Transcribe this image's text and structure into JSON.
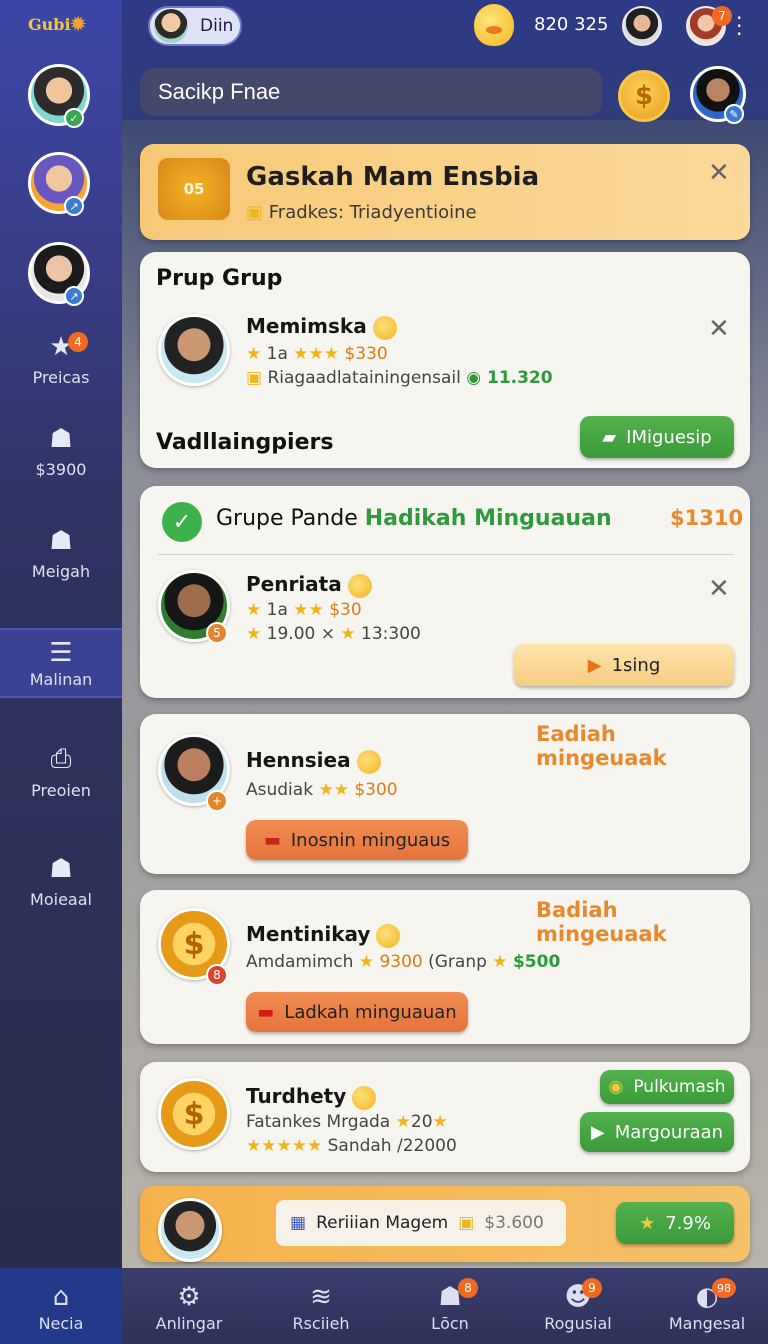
{
  "app": {
    "logo_text": "Gubi",
    "user_label": "Diin",
    "coins": "820 325",
    "notif_count": "7"
  },
  "search": {
    "value": "Sacikp Fnae"
  },
  "sidebar": {
    "items": [
      {
        "label": "Preicas",
        "icon": "star-icon",
        "badge": "4"
      },
      {
        "label": "$3900",
        "icon": "group-icon"
      },
      {
        "label": "Meigah",
        "icon": "bag-icon"
      },
      {
        "label": "Malinan",
        "icon": "list-icon"
      },
      {
        "label": "Preoien",
        "icon": "profile-icon"
      },
      {
        "label": "Moieaal",
        "icon": "bag-icon"
      }
    ]
  },
  "banner": {
    "cart_text": "05",
    "title": "Gaskah Mam Ensbia",
    "subtitle": "Fradkes: Triadyentioine"
  },
  "group_card": {
    "title": "Prup Grup",
    "name": "Memimska",
    "rating": "1a",
    "money": "$330",
    "detail": "Riagaadlatainingensail",
    "score": "11.320",
    "section": "Vadllaingpiers",
    "button": "IMiguesip"
  },
  "pande_card": {
    "title_a": "Grupe Pande",
    "title_b": "Hadikah Minguauan",
    "amount": "$1310",
    "name": "Penriata",
    "line1_rating": "1a",
    "line1_money": "$30",
    "line2_a": "19.00",
    "line2_b": "13:300",
    "button": "1sing",
    "avatar_badge": "5"
  },
  "card3": {
    "header": "Eadiah mingeuaak",
    "name": "Hennsiea",
    "line_a": "Asudiak",
    "money": "$300",
    "button": "Inosnin minguaus"
  },
  "card4": {
    "header": "Badiah mingeuaak",
    "name": "Mentinikay",
    "line_a": "Amdamimch",
    "num": "9300",
    "line_b": "(Granp",
    "money": "$500",
    "button": "Ladkah minguauan",
    "badge": "8"
  },
  "card5": {
    "name": "Turdhety",
    "line1": "Fatankes Mrgada",
    "line1_num": "20",
    "line2": "Sandah /22000",
    "button_top": "Pulkumash",
    "button_bottom": "Margouraan"
  },
  "promo": {
    "label": "Reriiian Magem",
    "amount": "$3.600",
    "percent": "7.9%"
  },
  "bottom_nav": [
    {
      "label": "Necia",
      "icon": "home-icon"
    },
    {
      "label": "Anlingar",
      "icon": "gear-icon"
    },
    {
      "label": "Rsciieh",
      "icon": "stack-icon"
    },
    {
      "label": "Lōcn",
      "icon": "users-icon",
      "badge": "8"
    },
    {
      "label": "Rogusial",
      "icon": "person-icon",
      "badge": "9"
    },
    {
      "label": "Mangesal",
      "icon": "avatar-icon",
      "badge": "98"
    }
  ]
}
